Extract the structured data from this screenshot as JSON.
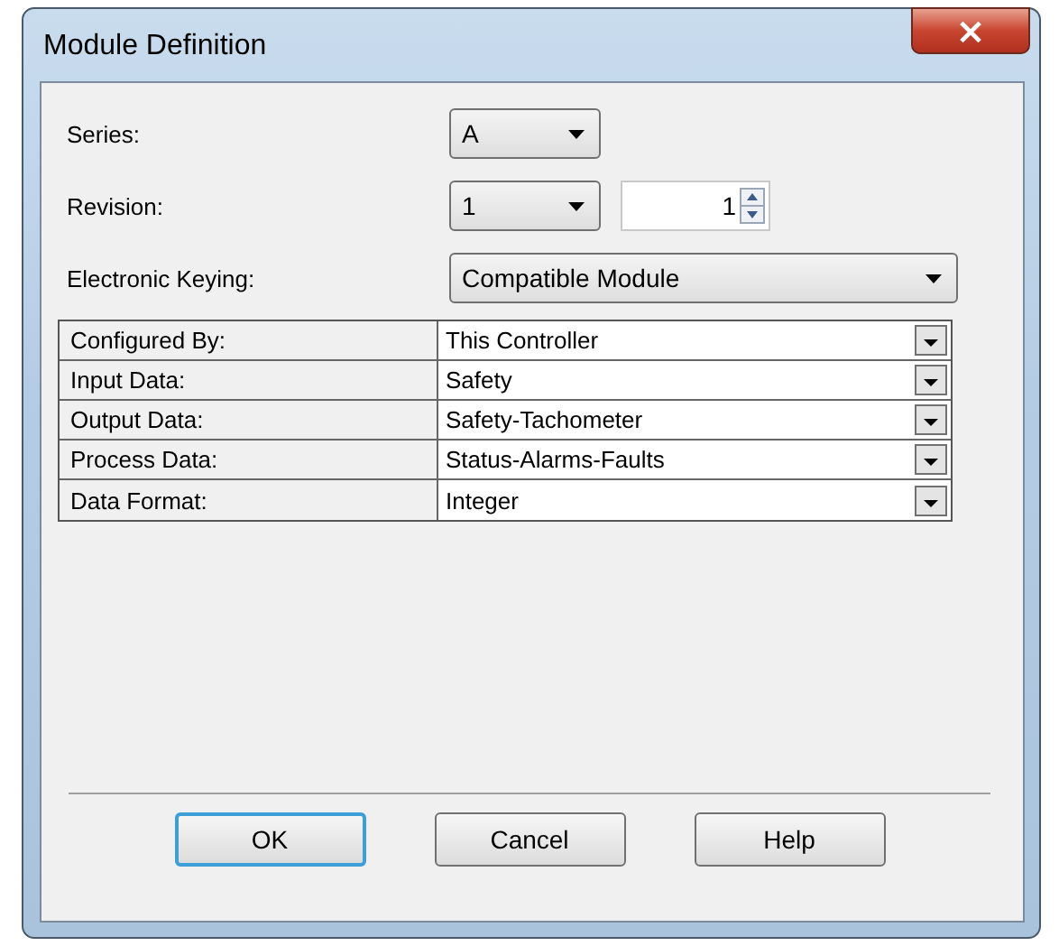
{
  "window": {
    "title": "Module Definition",
    "close": "×"
  },
  "fields": [
    {
      "label": "Series:",
      "kind": "dropdown",
      "value": "A"
    },
    {
      "label": "Revision:",
      "kind": "dropdown-spin",
      "value": "1",
      "spin_value": "1"
    },
    {
      "label": "Electronic Keying:",
      "kind": "wide-dropdown",
      "value": "Compatible Module"
    }
  ],
  "table": {
    "rows": [
      {
        "label": "Configured By:",
        "value": "This Controller"
      },
      {
        "label": "Input Data:",
        "value": "Safety"
      },
      {
        "label": "Output Data:",
        "value": "Safety-Tachometer"
      },
      {
        "label": "Process Data:",
        "value": "Status-Alarms-Faults"
      },
      {
        "label": "Data Format:",
        "value": "Integer"
      }
    ]
  },
  "buttons": [
    {
      "label": "OK",
      "default": true
    },
    {
      "label": "Cancel",
      "default": false
    },
    {
      "label": "Help",
      "default": false
    }
  ]
}
